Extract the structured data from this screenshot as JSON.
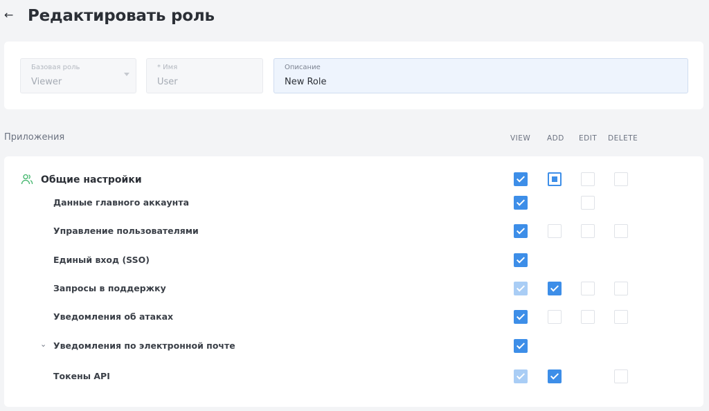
{
  "header": {
    "title": "Редактировать роль",
    "back_icon": "arrow-left-icon"
  },
  "form": {
    "base_role": {
      "label": "Базовая роль",
      "value": "Viewer"
    },
    "name": {
      "label": "* Имя",
      "value": "User"
    },
    "description": {
      "label": "Описание",
      "value": "New Role"
    }
  },
  "permissions": {
    "section_label": "Приложения",
    "columns": [
      "VIEW",
      "ADD",
      "EDIT",
      "DELETE"
    ],
    "group": {
      "title": "Общие настройки",
      "icon": "users-icon",
      "state": [
        "checked",
        "partial",
        "empty",
        "empty"
      ]
    },
    "rows": [
      {
        "label": "Данные главного аккаунта",
        "state": [
          "checked",
          null,
          "empty",
          null
        ]
      },
      {
        "label": "Управление пользователями",
        "state": [
          "checked",
          "empty",
          "empty",
          "empty"
        ]
      },
      {
        "label": "Единый вход (SSO)",
        "state": [
          "checked",
          null,
          null,
          null
        ]
      },
      {
        "label": "Запросы в поддержку",
        "state": [
          "checked-dim",
          "checked",
          "empty",
          "empty"
        ]
      },
      {
        "label": "Уведомления об атаках",
        "state": [
          "checked",
          "empty",
          "empty",
          "empty"
        ]
      },
      {
        "label": "Уведомления по электронной почте",
        "state": [
          "checked",
          null,
          null,
          null
        ],
        "expandable": true
      },
      {
        "label": "Токены API",
        "state": [
          "checked-dim",
          "checked",
          null,
          "empty"
        ]
      }
    ]
  },
  "colors": {
    "accent": "#3d8ee8",
    "accent_dim": "#a9cdf5",
    "group_icon": "#3fb56a"
  }
}
